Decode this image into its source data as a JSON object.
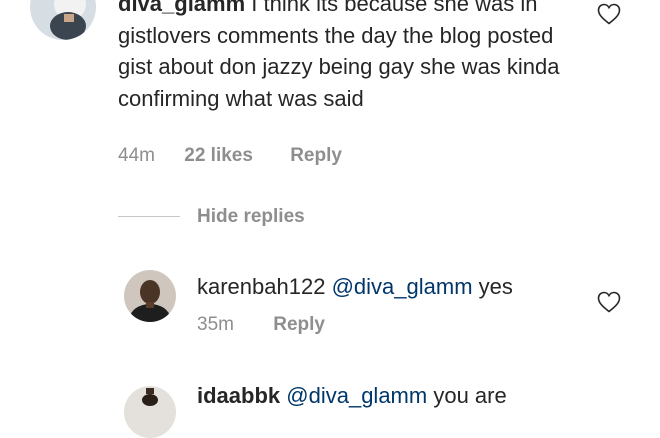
{
  "comment": {
    "username": "diva_glamm",
    "text": "I think its because she was in gistlovers comments the day the blog posted gist about don jazzy being gay she was kinda confirming what was said",
    "time": "44m",
    "likes": "22 likes",
    "reply_label": "Reply"
  },
  "thread": {
    "hide_replies_label": "Hide replies"
  },
  "replies": [
    {
      "username": "karenbah122",
      "mention": "@diva_glamm",
      "text": "yes",
      "time": "35m",
      "reply_label": "Reply"
    },
    {
      "username": "idaabbk",
      "mention": "@diva_glamm",
      "text": "you are"
    }
  ],
  "colors": {
    "text": "#262626",
    "secondary": "#8e8e8e",
    "mention": "#00376b"
  }
}
